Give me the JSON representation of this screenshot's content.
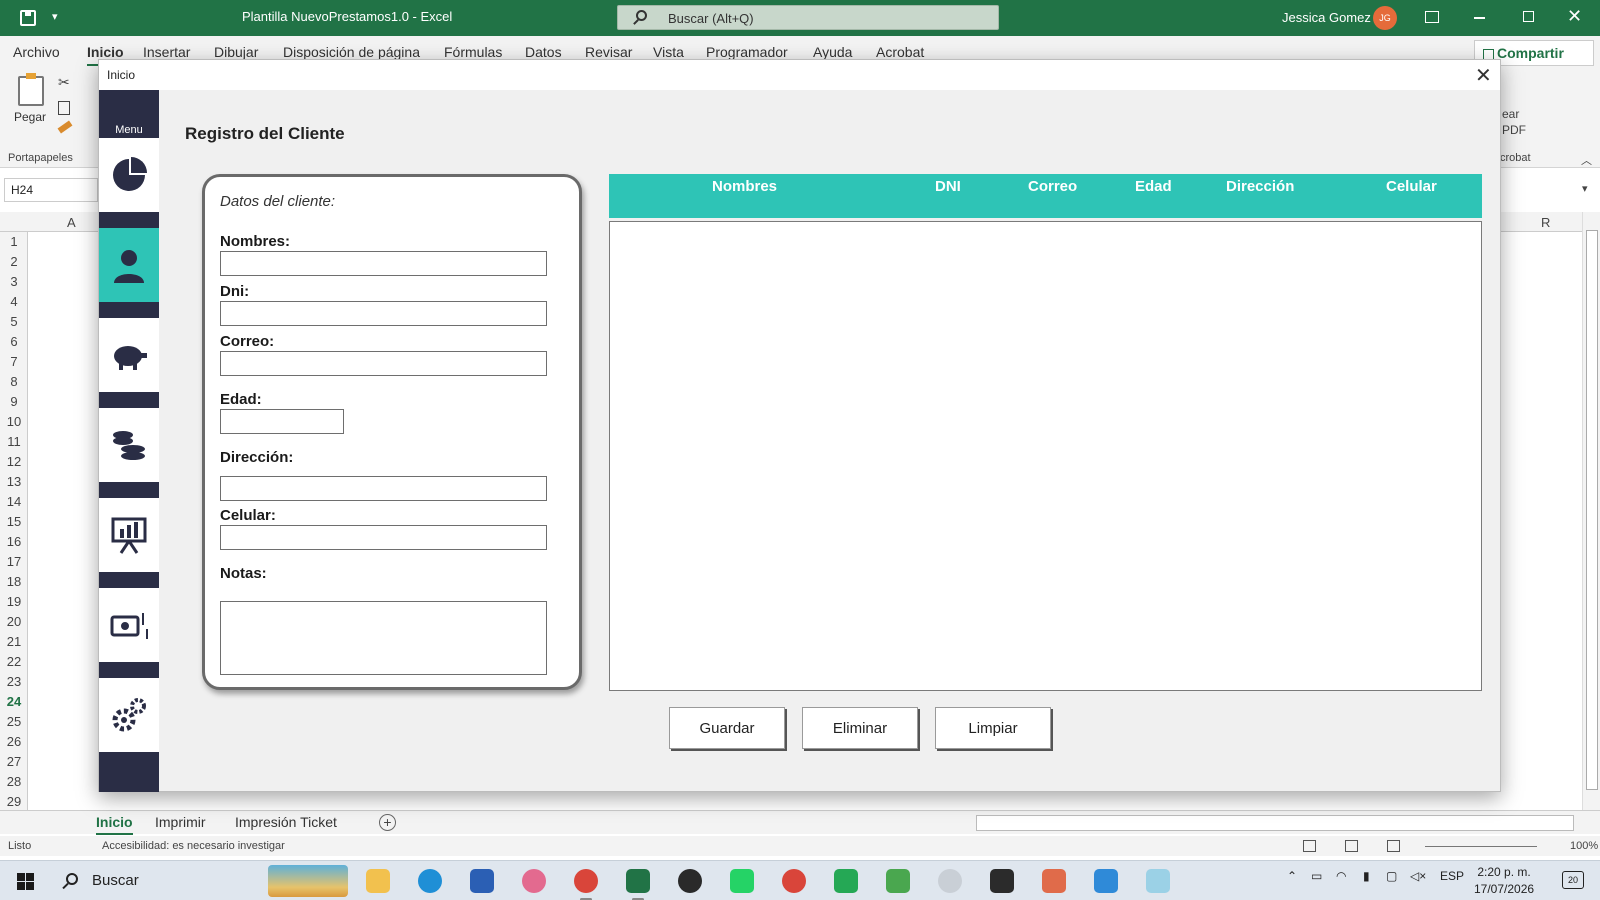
{
  "excel": {
    "title": "Plantilla NuevoPrestamos1.0  -  Excel",
    "search_placeholder": "Buscar (Alt+Q)",
    "user_name": "Jessica Gomez",
    "user_initials": "JG",
    "ribbon_tabs": [
      "Archivo",
      "Inicio",
      "Insertar",
      "Dibujar",
      "Disposición de página",
      "Fórmulas",
      "Datos",
      "Revisar",
      "Vista",
      "Programador",
      "Ayuda",
      "Acrobat"
    ],
    "active_tab": "Inicio",
    "share_label": "Compartir",
    "paste_label": "Pegar",
    "clipboard_group": "Portapapeles",
    "acrobat_partial": [
      "ear",
      "PDF"
    ],
    "acrobat_group_partial": "crobat",
    "name_box": "H24",
    "column_labels": [
      "A",
      "R"
    ],
    "row_numbers": [
      "1",
      "2",
      "3",
      "4",
      "5",
      "6",
      "7",
      "8",
      "9",
      "10",
      "11",
      "12",
      "13",
      "14",
      "15",
      "16",
      "17",
      "18",
      "19",
      "20",
      "21",
      "22",
      "23",
      "24",
      "25",
      "26",
      "27",
      "28",
      "29"
    ],
    "selected_row": "24",
    "sheet_tabs": [
      "Inicio",
      "Imprimir",
      "Impresión Ticket"
    ],
    "active_sheet": "Inicio",
    "status_ready": "Listo",
    "accessibility": "Accesibilidad: es necesario investigar",
    "zoom": "100%"
  },
  "taskbar": {
    "search_label": "Buscar",
    "language": "ESP",
    "time": "2:20 p. m.",
    "date": "17/07/2026",
    "notifications": "20",
    "apps": [
      "file-explorer",
      "edge",
      "word",
      "snipping-tool",
      "chrome",
      "excel",
      "obs",
      "whatsapp",
      "chrome-profile",
      "whatsapp-business",
      "google-drive",
      "app-launcher",
      "sticky-notes",
      "chrome-profile-2",
      "app-blue",
      "paint"
    ]
  },
  "userform": {
    "window_title": "Inicio",
    "menu_label": "Menu",
    "heading": "Registro del Cliente",
    "panel_caption": "Datos del cliente:",
    "fields": {
      "nombres": "Nombres:",
      "dni": "Dni:",
      "correo": "Correo:",
      "edad": "Edad:",
      "direccion": "Dirección:",
      "celular": "Celular:",
      "notas": "Notas:"
    },
    "grid_columns": [
      "Nombres",
      "DNI",
      "Correo",
      "Edad",
      "Dirección",
      "Celular"
    ],
    "buttons": {
      "guardar": "Guardar",
      "eliminar": "Eliminar",
      "limpiar": "Limpiar"
    },
    "menu_items": [
      "dashboard-pie-icon",
      "client-user-icon",
      "savings-piggy-icon",
      "coins-icon",
      "report-chart-icon",
      "payments-icon",
      "settings-gears-icon"
    ],
    "active_menu_item": "client-user-icon"
  },
  "colors": {
    "excel_green": "#217346",
    "menu_rail": "#2a2d45",
    "accent_teal": "#2ec4b6"
  }
}
